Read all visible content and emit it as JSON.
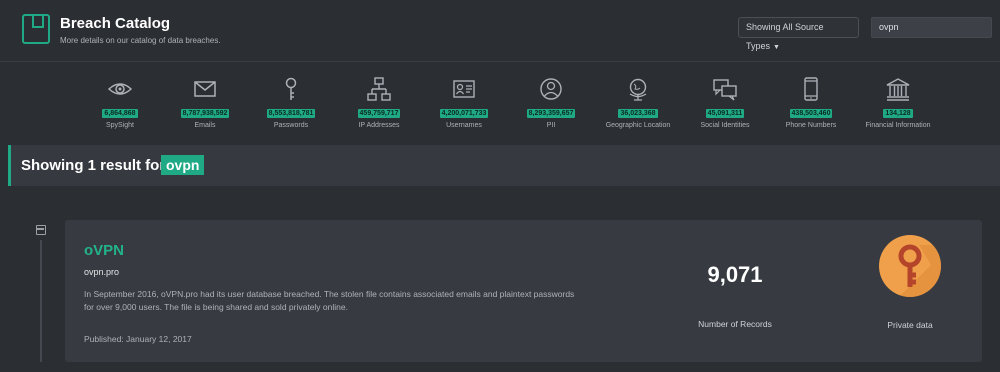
{
  "header": {
    "title": "Breach Catalog",
    "subtitle": "More details on our catalog of data breaches.",
    "source_dropdown": "Showing All Source Types",
    "search_value": "ovpn"
  },
  "stats": [
    {
      "icon": "eye-icon",
      "value": "6,864,868",
      "label": "SpySight"
    },
    {
      "icon": "envelope-icon",
      "value": "8,787,938,592",
      "label": "Emails"
    },
    {
      "icon": "key-icon",
      "value": "8,553,818,781",
      "label": "Passwords"
    },
    {
      "icon": "network-icon",
      "value": "459,759,717",
      "label": "IP Addresses"
    },
    {
      "icon": "id-card-icon",
      "value": "4,200,071,733",
      "label": "Usernames"
    },
    {
      "icon": "person-icon",
      "value": "8,293,359,657",
      "label": "PII"
    },
    {
      "icon": "globe-icon",
      "value": "36,023,368",
      "label": "Geographic Location"
    },
    {
      "icon": "chat-icon",
      "value": "45,091,311",
      "label": "Social Identities"
    },
    {
      "icon": "phone-icon",
      "value": "438,503,460",
      "label": "Phone Numbers"
    },
    {
      "icon": "bank-icon",
      "value": "134,128",
      "label": "Financial Information"
    }
  ],
  "result": {
    "prefix": "Showing 1 result for:",
    "query": "ovpn"
  },
  "breach": {
    "title": "oVPN",
    "domain": "ovpn.pro",
    "description": "In September 2016, oVPN.pro had its user database breached. The stolen file contains associated emails and plaintext passwords for over 9,000 users. The file is being shared and sold privately online.",
    "published": "Published: January 12, 2017",
    "records": "9,071",
    "records_label": "Number of Records",
    "private_label": "Private data"
  },
  "colors": {
    "accent": "#1fa985",
    "background": "#2b2e33",
    "card": "#373b41",
    "private_badge": "#f0a04b",
    "key": "#b4452b"
  }
}
